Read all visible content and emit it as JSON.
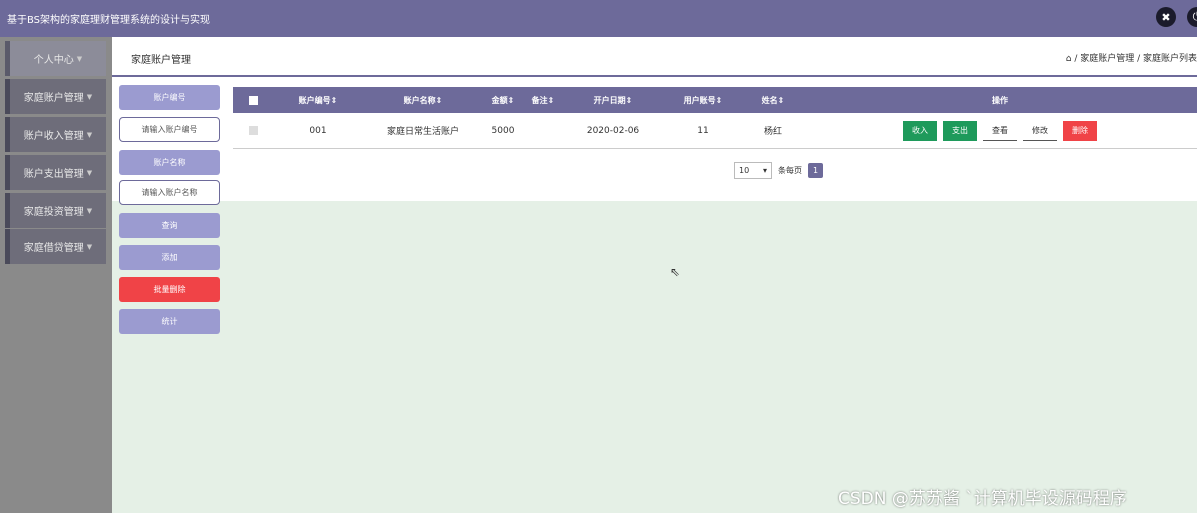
{
  "app": {
    "title": "基于BS架构的家庭理财管理系统的设计与实现"
  },
  "topbar_icons": [
    "close-circle-icon",
    "logout-icon"
  ],
  "sidebar": {
    "items": [
      {
        "label": "个人中心"
      },
      {
        "label": "家庭账户管理"
      },
      {
        "label": "账户收入管理"
      },
      {
        "label": "账户支出管理"
      },
      {
        "label": "家庭投资管理"
      },
      {
        "label": "家庭借贷管理"
      }
    ]
  },
  "page": {
    "title": "家庭账户管理",
    "breadcrumb": "⌂ / 家庭账户管理 / 家庭账户列表"
  },
  "filters": {
    "account_no_label": "账户编号",
    "account_no_placeholder": "请输入账户编号",
    "account_name_label": "账户名称",
    "account_name_placeholder": "请输入账户名称",
    "query": "查询",
    "add": "添加",
    "batch_delete": "批量删除",
    "stats": "统计"
  },
  "table": {
    "headers": [
      "账户编号",
      "账户名称",
      "金额",
      "备注",
      "开户日期",
      "用户账号",
      "姓名",
      "操作"
    ],
    "rows": [
      {
        "account_no": "001",
        "account_name": "家庭日常生活账户",
        "amount": "5000",
        "remark": "",
        "open_date": "2020-02-06",
        "user_account": "11",
        "name": "杨红"
      }
    ],
    "actions": [
      "收入",
      "支出",
      "查看",
      "修改",
      "删除"
    ]
  },
  "pagination": {
    "page_size": "10",
    "per_page_label": "条每页",
    "current_page": "1"
  },
  "colors": {
    "header": "#6d6a9a",
    "accent": "#9b9bd0",
    "danger": "#f04347",
    "success": "#1e9a5b"
  },
  "watermark": "CSDN @苏苏酱    `计算机毕设源码程序"
}
